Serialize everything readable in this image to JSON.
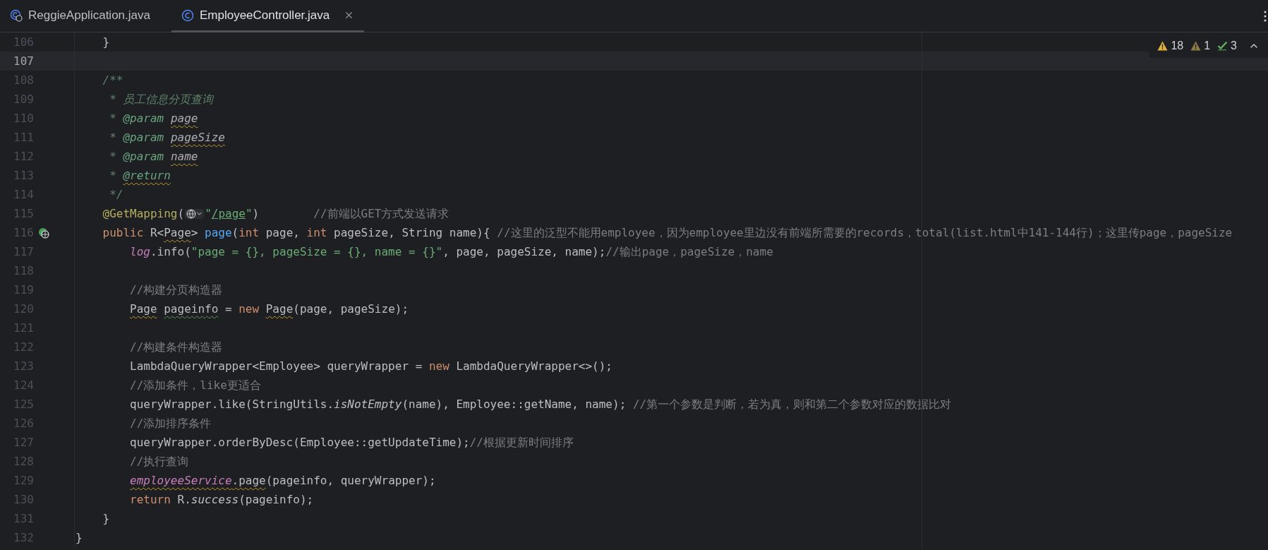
{
  "tabs": [
    {
      "label": "ReggieApplication.java",
      "kind": "app",
      "selected": false
    },
    {
      "label": "EmployeeController.java",
      "kind": "class",
      "selected": true
    }
  ],
  "inspections": [
    {
      "kind": "warning",
      "count": "18"
    },
    {
      "kind": "weak-warning",
      "count": "1"
    },
    {
      "kind": "typo",
      "count": "3"
    }
  ],
  "lines": [
    {
      "number": "106",
      "current": false,
      "tokens": [
        {
          "kind": "plain",
          "text": "    }"
        }
      ]
    },
    {
      "number": "107",
      "current": true
    },
    {
      "number": "108",
      "current": false,
      "tokens": [
        {
          "kind": "doc",
          "text": "    /**"
        }
      ]
    },
    {
      "number": "109",
      "current": false,
      "tokens": [
        {
          "kind": "doc",
          "text": "     * 员工信息分页查询"
        }
      ]
    },
    {
      "number": "110",
      "current": false,
      "tokens": [
        {
          "kind": "doc",
          "text": "     * "
        },
        {
          "kind": "doctag",
          "text": "@param"
        },
        {
          "kind": "docparam",
          "text": " page",
          "warning_underline": true
        }
      ]
    },
    {
      "number": "111",
      "current": false,
      "tokens": [
        {
          "kind": "doc",
          "text": "     * "
        },
        {
          "kind": "doctag",
          "text": "@param"
        },
        {
          "kind": "docparam",
          "text": " pageSize",
          "warning_underline": true
        }
      ]
    },
    {
      "number": "112",
      "current": false,
      "tokens": [
        {
          "kind": "doc",
          "text": "     * "
        },
        {
          "kind": "doctag",
          "text": "@param"
        },
        {
          "kind": "docparam",
          "text": " name",
          "warning_underline": true
        }
      ]
    },
    {
      "number": "113",
      "current": false,
      "tokens": [
        {
          "kind": "doc",
          "text": "     * "
        },
        {
          "kind": "doctag",
          "text": "@return",
          "warning_underline": true
        }
      ]
    },
    {
      "number": "114",
      "current": false,
      "tokens": [
        {
          "kind": "doc",
          "text": "     */"
        }
      ]
    },
    {
      "number": "115",
      "current": false,
      "tokens": [
        {
          "kind": "annotation",
          "text": "    @GetMapping"
        },
        {
          "kind": "plain",
          "text": "("
        },
        {
          "kind": "hint"
        },
        {
          "kind": "string",
          "text": "\""
        },
        {
          "kind": "url",
          "text": "/page"
        },
        {
          "kind": "string",
          "text": "\""
        },
        {
          "kind": "plain",
          "text": ")"
        },
        {
          "kind": "comment",
          "text": "        //前端以GET方式发送请求"
        }
      ]
    },
    {
      "number": "116",
      "current": false,
      "endpoint_icon": true,
      "tokens": [
        {
          "kind": "keyword",
          "text": "    public "
        },
        {
          "kind": "plain",
          "text": "R<"
        },
        {
          "kind": "plain",
          "text": "Page",
          "warning_underline": true
        },
        {
          "kind": "plain",
          "text": "> "
        },
        {
          "kind": "decl",
          "text": "page"
        },
        {
          "kind": "plain",
          "text": "("
        },
        {
          "kind": "keyword",
          "text": "int "
        },
        {
          "kind": "plain",
          "text": "page, "
        },
        {
          "kind": "keyword",
          "text": "int "
        },
        {
          "kind": "plain",
          "text": "pageSize, String name){ "
        },
        {
          "kind": "comment",
          "text": "//这里的泛型不能用employee，因为employee里边没有前端所需要的records，total(list.html中141-144行)；这里传page，pageSize"
        }
      ]
    },
    {
      "number": "117",
      "current": false,
      "tokens": [
        {
          "kind": "field",
          "text": "        log"
        },
        {
          "kind": "plain",
          "text": ".info("
        },
        {
          "kind": "string",
          "text": "\"page = {}, pageSize = {}, name = {}\""
        },
        {
          "kind": "plain",
          "text": ", page, pageSize, name);"
        },
        {
          "kind": "comment",
          "text": "//输出page，pageSize，name"
        }
      ]
    },
    {
      "number": "118",
      "current": false
    },
    {
      "number": "119",
      "current": false,
      "tokens": [
        {
          "kind": "comment",
          "text": "        //构建分页构造器"
        }
      ]
    },
    {
      "number": "120",
      "current": false,
      "tokens": [
        {
          "kind": "plain",
          "text": "        Page",
          "warning_underline": true
        },
        {
          "kind": "plain",
          "text": " pageinfo",
          "typo_underline": true
        },
        {
          "kind": "plain",
          "text": " = "
        },
        {
          "kind": "keyword",
          "text": "new "
        },
        {
          "kind": "plain",
          "text": "Page",
          "warning_underline": true
        },
        {
          "kind": "plain",
          "text": "(page, pageSize);"
        }
      ]
    },
    {
      "number": "121",
      "current": false
    },
    {
      "number": "122",
      "current": false,
      "tokens": [
        {
          "kind": "comment",
          "text": "        //构建条件构造器"
        }
      ]
    },
    {
      "number": "123",
      "current": false,
      "tokens": [
        {
          "kind": "plain",
          "text": "        LambdaQueryWrapper<Employee> queryWrapper = "
        },
        {
          "kind": "keyword",
          "text": "new "
        },
        {
          "kind": "plain",
          "text": "LambdaQueryWrapper<>();"
        }
      ]
    },
    {
      "number": "124",
      "current": false,
      "tokens": [
        {
          "kind": "comment",
          "text": "        //添加条件，like更适合"
        }
      ]
    },
    {
      "number": "125",
      "current": false,
      "tokens": [
        {
          "kind": "plain",
          "text": "        queryWrapper.like(StringUtils."
        },
        {
          "kind": "static",
          "text": "isNotEmpty"
        },
        {
          "kind": "plain",
          "text": "(name), Employee::getName, name); "
        },
        {
          "kind": "comment",
          "text": "//第一个参数是判断，若为真，则和第二个参数对应的数据比对"
        }
      ]
    },
    {
      "number": "126",
      "current": false,
      "tokens": [
        {
          "kind": "comment",
          "text": "        //添加排序条件"
        }
      ]
    },
    {
      "number": "127",
      "current": false,
      "tokens": [
        {
          "kind": "plain",
          "text": "        queryWrapper.orderByDesc(Employee::getUpdateTime);"
        },
        {
          "kind": "comment",
          "text": "//根据更新时间排序"
        }
      ]
    },
    {
      "number": "128",
      "current": false,
      "tokens": [
        {
          "kind": "comment",
          "text": "        //执行查询"
        }
      ]
    },
    {
      "number": "129",
      "current": false,
      "tokens": [
        {
          "kind": "field",
          "text": "        employeeService",
          "warning_underline": true
        },
        {
          "kind": "plain",
          "text": ".page",
          "warning_underline": true
        },
        {
          "kind": "plain",
          "text": "(pageinfo, queryWrapper);"
        }
      ]
    },
    {
      "number": "130",
      "current": false,
      "tokens": [
        {
          "kind": "keyword",
          "text": "        return "
        },
        {
          "kind": "plain",
          "text": "R."
        },
        {
          "kind": "static",
          "text": "success"
        },
        {
          "kind": "plain",
          "text": "(pageinfo);"
        }
      ]
    },
    {
      "number": "131",
      "current": false,
      "tokens": [
        {
          "kind": "plain",
          "text": "    }"
        }
      ]
    },
    {
      "number": "132",
      "current": false,
      "tokens": [
        {
          "kind": "plain",
          "text": "}"
        }
      ]
    }
  ]
}
